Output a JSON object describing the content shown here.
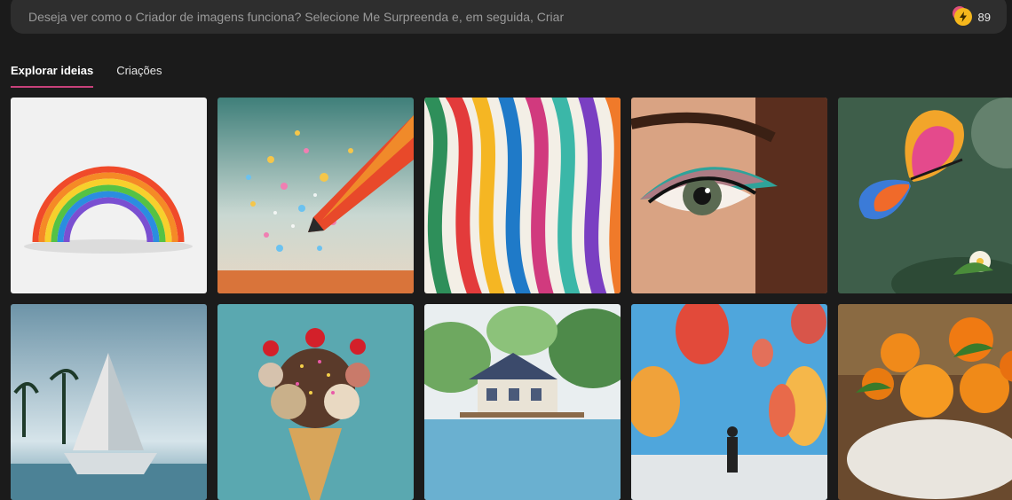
{
  "prompt": {
    "placeholder": "Deseja ver como o Criador de imagens funciona? Selecione Me Surpreenda e, em seguida, Criar"
  },
  "boosts": {
    "icon": "lightning-coin-icon",
    "count": "89"
  },
  "tabs": [
    {
      "label": "Explorar ideias",
      "active": true
    },
    {
      "label": "Criações",
      "active": false
    }
  ],
  "gallery": [
    {
      "subject": "paper rainbow"
    },
    {
      "subject": "colored pencil with glitter"
    },
    {
      "subject": "wavy colorful ribbons"
    },
    {
      "subject": "eye with colorful makeup"
    },
    {
      "subject": "rainbow butterfly and flower"
    },
    {
      "subject": "origami sailboat at sea"
    },
    {
      "subject": "ice cream cone with cherries"
    },
    {
      "subject": "lake house watercolor"
    },
    {
      "subject": "hot air balloons with person"
    },
    {
      "subject": "oranges in a bowl"
    }
  ],
  "colors": {
    "accent": "#c7417a",
    "background": "#1b1b1b",
    "bar": "#2e2e2e",
    "coin": "#f5b71c"
  }
}
